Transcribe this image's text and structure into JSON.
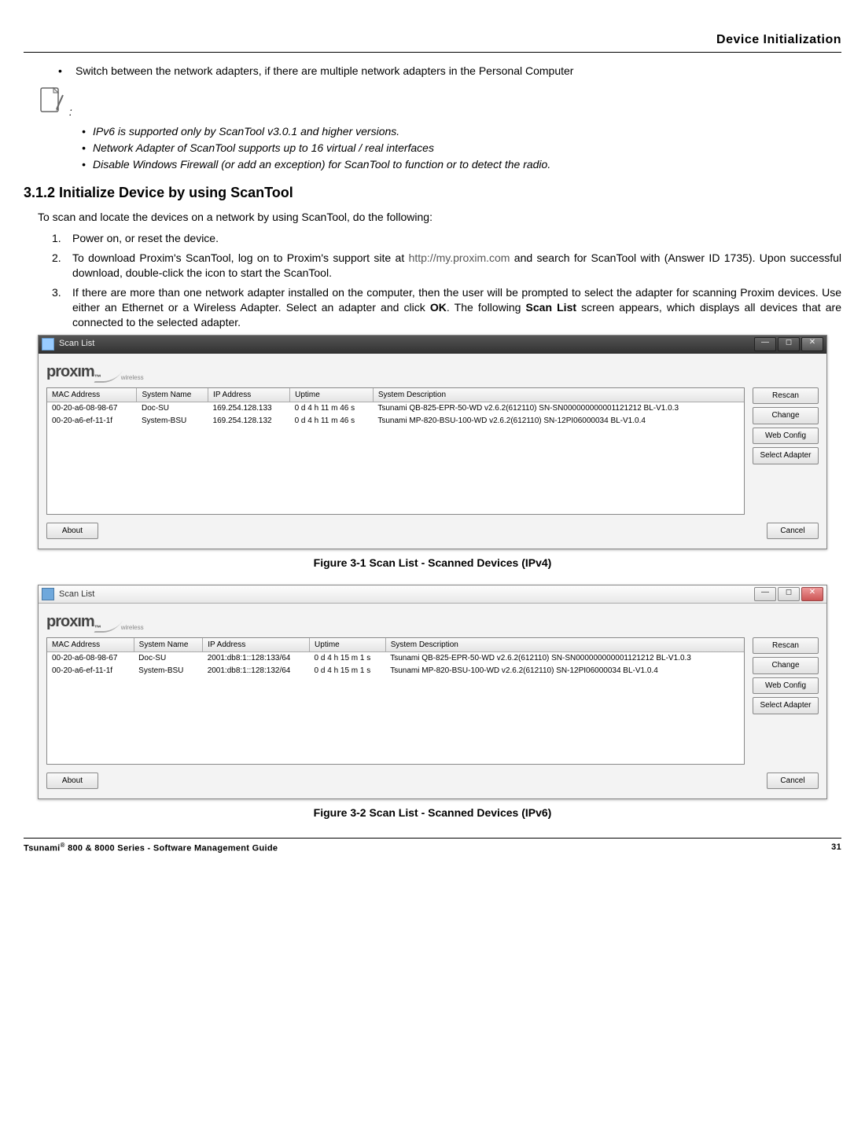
{
  "header": {
    "title": "Device Initialization"
  },
  "top_bullet": "Switch between the network adapters, if there are multiple network adapters in the Personal Computer",
  "note_colon": ":",
  "sub_bullets": [
    "IPv6 is supported only by ScanTool v3.0.1 and higher versions.",
    "Network Adapter of ScanTool supports up to 16 virtual / real interfaces",
    "Disable Windows Firewall (or add an exception) for ScanTool to function or to detect the radio."
  ],
  "section_heading": "3.1.2 Initialize Device by using ScanTool",
  "intro_text": "To scan and locate the devices on a network by using ScanTool, do the following:",
  "steps": {
    "s1_num": "1.",
    "s1_text": "Power on, or reset the device.",
    "s2_num": "2.",
    "s2_a": "To download Proxim's ScanTool, log on to Proxim's support site at ",
    "s2_link": "http://my.proxim.com",
    "s2_b": " and search for ScanTool with (Answer ID 1735). Upon successful download, double-click the icon to start the ScanTool.",
    "s3_num": "3.",
    "s3_a": "If there are more than one network adapter installed on the computer, then the user will be prompted to select the adapter for scanning Proxim devices. Use either an Ethernet or a Wireless Adapter. Select an adapter and click ",
    "s3_bold1": "OK",
    "s3_b": ". The following ",
    "s3_bold2": "Scan List",
    "s3_c": " screen appears, which displays all devices that are connected to the selected adapter."
  },
  "figure1_caption": "Figure 3-1 Scan List - Scanned Devices (IPv4)",
  "figure2_caption": "Figure 3-2 Scan List - Scanned Devices (IPv6)",
  "scanlist": {
    "title": "Scan List",
    "logo_text": "prox",
    "logo_suffix": "ım",
    "logo_tm": "™",
    "logo_sub": "wireless",
    "columns": [
      "MAC Address",
      "System Name",
      "IP Address",
      "Uptime",
      "System Description"
    ],
    "buttons": {
      "rescan": "Rescan",
      "change": "Change",
      "webconfig": "Web Config",
      "selectadapter": "Select Adapter",
      "about": "About",
      "cancel": "Cancel"
    },
    "ipv4_rows": [
      {
        "mac": "00-20-a6-08-98-67",
        "name": "Doc-SU",
        "ip": "169.254.128.133",
        "uptime": "0 d 4 h 11 m 46 s",
        "desc": "Tsunami QB-825-EPR-50-WD v2.6.2(612110)  SN-SN000000000001121212 BL-V1.0.3"
      },
      {
        "mac": "00-20-a6-ef-11-1f",
        "name": "System-BSU",
        "ip": "169.254.128.132",
        "uptime": "0 d 4 h 11 m 46 s",
        "desc": "Tsunami MP-820-BSU-100-WD v2.6.2(612110)  SN-12PI06000034 BL-V1.0.4"
      }
    ],
    "ipv6_rows": [
      {
        "mac": "00-20-a6-08-98-67",
        "name": "Doc-SU",
        "ip": "2001:db8:1::128:133/64",
        "uptime": "0 d 4 h 15 m 1 s",
        "desc": "Tsunami QB-825-EPR-50-WD v2.6.2(612110)  SN-SN000000000001121212 BL-V1.0.3"
      },
      {
        "mac": "00-20-a6-ef-11-1f",
        "name": "System-BSU",
        "ip": "2001:db8:1::128:132/64",
        "uptime": "0 d 4 h 15 m 1 s",
        "desc": "Tsunami MP-820-BSU-100-WD v2.6.2(612110)  SN-12PI06000034 BL-V1.0.4"
      }
    ]
  },
  "footer": {
    "left_a": "Tsunami",
    "left_reg": "®",
    "left_b": " 800 & 8000 Series - Software Management Guide",
    "page": "31"
  }
}
